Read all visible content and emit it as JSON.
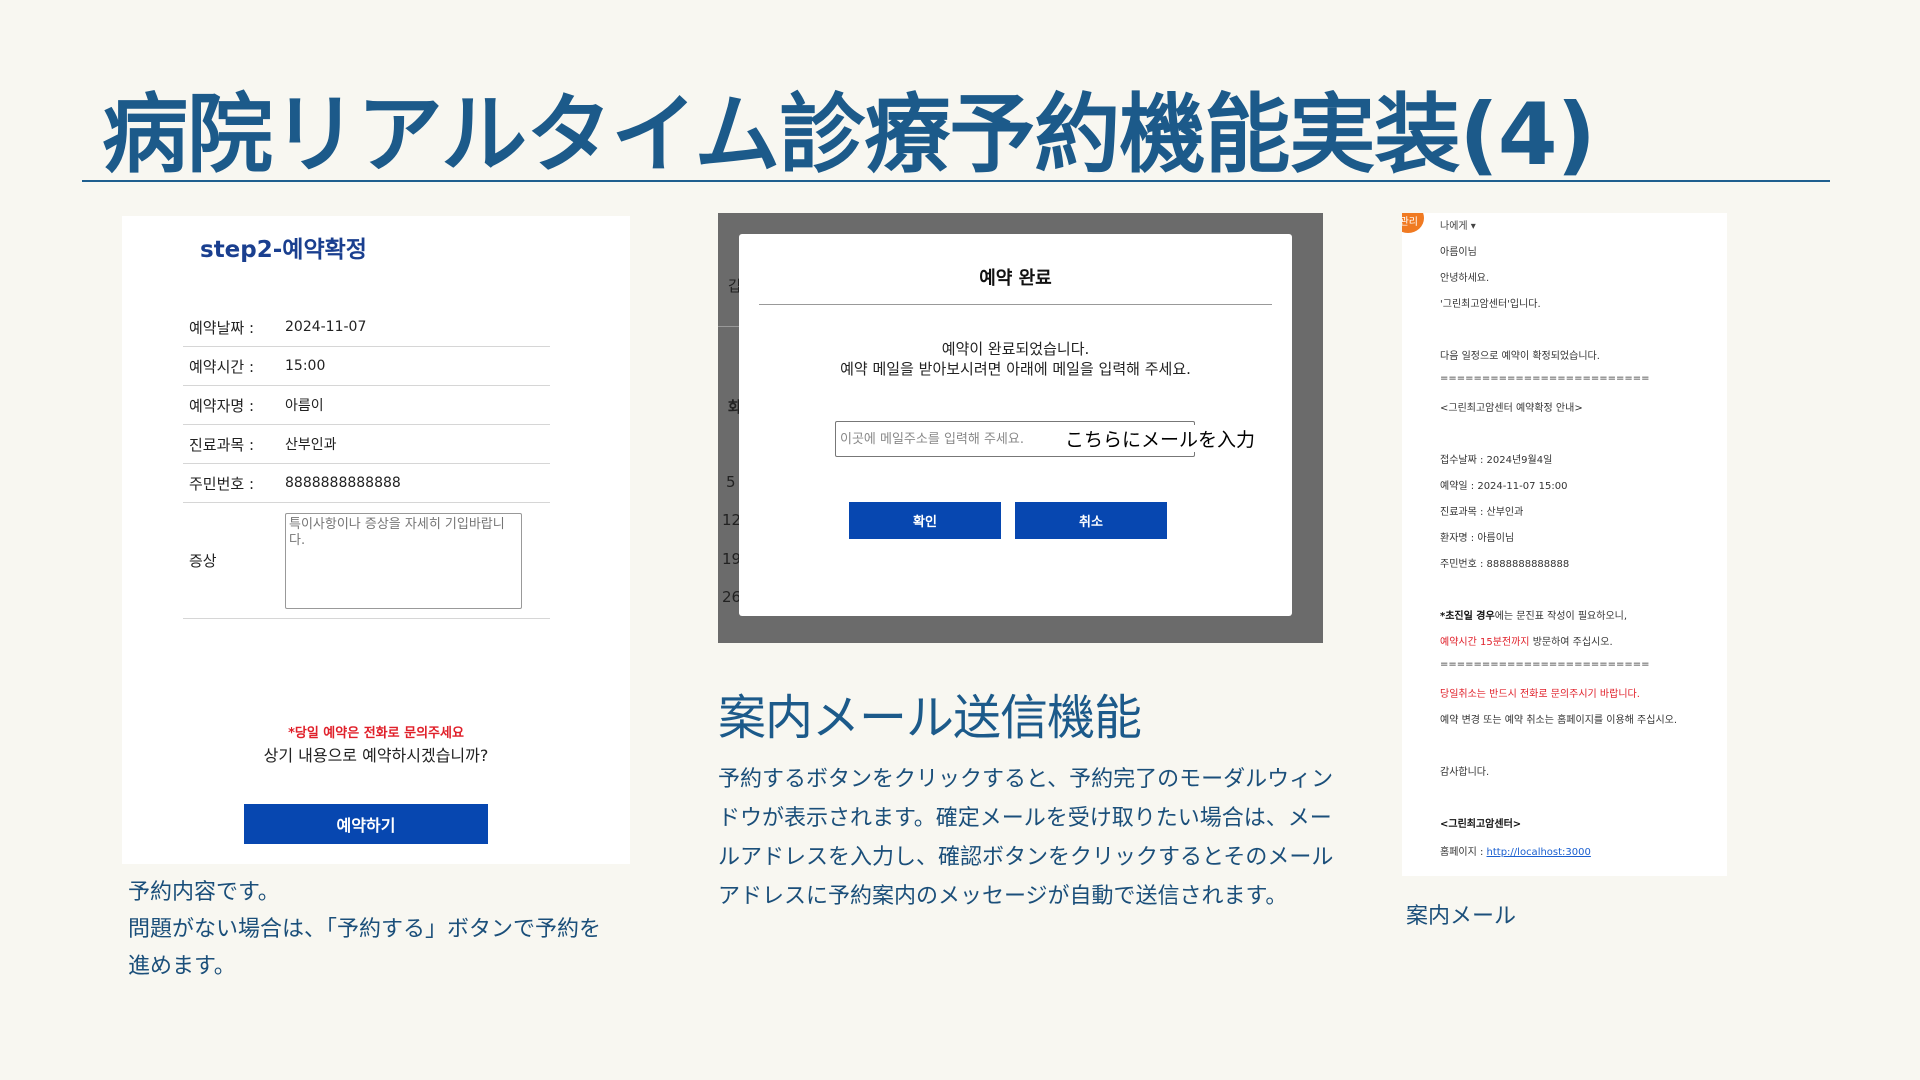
{
  "slide": {
    "title": "病院リアルタイム診療予約機能実装(4)"
  },
  "panel1": {
    "step_title": "step2-예약확정",
    "rows": [
      {
        "label": "예약날짜 :",
        "value": "2024-11-07"
      },
      {
        "label": "예약시간 :",
        "value": "15:00"
      },
      {
        "label": "예약자명 :",
        "value": "아름이"
      },
      {
        "label": "진료과목 :",
        "value": "산부인과"
      },
      {
        "label": "주민번호 :",
        "value": "8888888888888"
      }
    ],
    "symptom_label": "증상",
    "symptom_placeholder": "특이사항이나 증상을 자세히 기입바랍니다.",
    "notice": "*당일 예약은 전화로 문의주세요",
    "question": "상기 내용으로 예약하시겠습니까?",
    "reserve_button": "예약하기",
    "caption_lines": [
      "予約内容です。",
      "問題がない場合は、「予約する」ボタンで予約を",
      "進めます。"
    ]
  },
  "panel2": {
    "bg_fragments": [
      "갑",
      "화",
      "5",
      "12",
      "19",
      "26"
    ],
    "modal_title": "예약 완료",
    "message_line1": "예약이 완료되었습니다.",
    "message_line2": "예약 메일을 받아보시려면 아래에 메일을 입력해 주세요.",
    "email_placeholder": "이곳에 메일주소를 입력해 주세요.",
    "overlay_annotation": "こちらにメールを入力",
    "ok_button": "확인",
    "cancel_button": "취소",
    "heading": "案内メール送信機能",
    "description_lines": [
      "予約するボタンをクリックすると、予約完了のモーダルウィン",
      "ドウが表示されます。確定メールを受け取りたい場合は、メー",
      "ルアドレスを入力し、確認ボタンをクリックするとそのメール",
      "アドレスに予約案内のメッセージが自動で送信されます。"
    ]
  },
  "panel3": {
    "avatar_text": "관리",
    "to_label": "나에게 ▾",
    "lines": {
      "greeting_name": "아름이님",
      "hello": "안녕하세요.",
      "intro": "'그린최고암센터'입니다.",
      "confirmed": "다음 일정으로 예약이 확정되었습니다.",
      "separator1": "=========================",
      "notice_header": "<그린최고암센터 예약확정 안내>",
      "received_date": "접수날짜 : 2024년9월4일",
      "reservation_date": "예약일 : 2024-11-07 15:00",
      "department": "진료과목 : 산부인과",
      "patient": "환자명 : 아름이님",
      "id_number": "주민번호 : 8888888888888",
      "first_visit_bold": "*초진일 경우",
      "first_visit_rest": "에는 문진표 작성이 필요하오니,",
      "arrive_red": "예약시간 15분전까지",
      "arrive_rest": " 방문하여 주십시오.",
      "separator2": "=========================",
      "cancel_notice": "당일취소는 반드시 전화로 문의주시기 바랍니다.",
      "change_notice": "예약 변경 또는 예약 취소는 홈페이지를 이용해 주십시오.",
      "thanks": "감사합니다.",
      "signature": "<그린최고암센터>",
      "homepage_label": "홈페이지 : ",
      "homepage_link": "http://localhost:3000"
    },
    "caption": "案内メール"
  },
  "colors": {
    "background": "#f8f7f1",
    "title": "#1c5a8a",
    "button_blue": "#0747b0",
    "alert_red": "#e0202a",
    "modal_backdrop": "#6b6b6b",
    "avatar_orange": "#f07a22"
  }
}
